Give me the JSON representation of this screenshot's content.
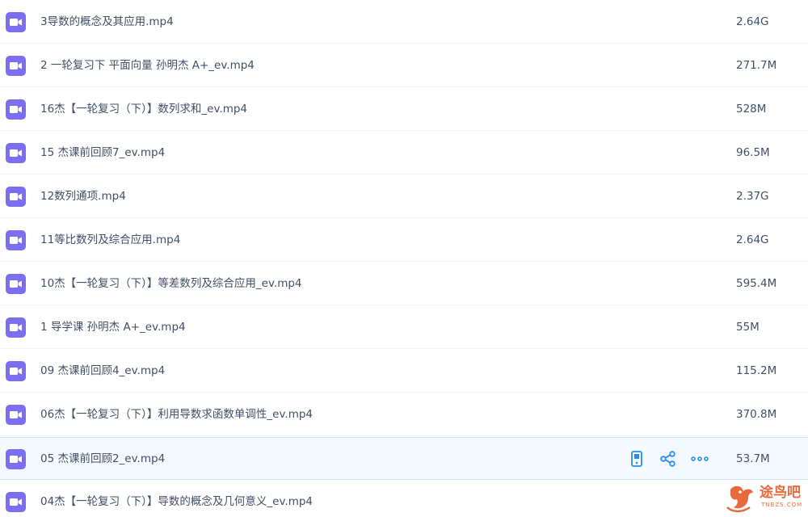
{
  "colors": {
    "icon": "#7b6ff0",
    "text": "#424e67",
    "action": "#2b8cf0",
    "highlight": "#f3f9fe",
    "watermark": "#e8693b"
  },
  "files": [
    {
      "name": "3导数的概念及其应用.mp4",
      "size": "2.64G",
      "icon": "video-file-icon"
    },
    {
      "name": "2 一轮复习下 平面向量 孙明杰 A+_ev.mp4",
      "size": "271.7M",
      "icon": "video-file-icon"
    },
    {
      "name": "16杰【一轮复习（下）】数列求和_ev.mp4",
      "size": "528M",
      "icon": "video-file-icon"
    },
    {
      "name": "15 杰课前回顾7_ev.mp4",
      "size": "96.5M",
      "icon": "video-file-icon"
    },
    {
      "name": "12数列通项.mp4",
      "size": "2.37G",
      "icon": "video-file-icon"
    },
    {
      "name": "11等比数列及综合应用.mp4",
      "size": "2.64G",
      "icon": "video-file-icon"
    },
    {
      "name": "10杰【一轮复习（下）】等差数列及综合应用_ev.mp4",
      "size": "595.4M",
      "icon": "video-file-icon"
    },
    {
      "name": "1 导学课 孙明杰 A+_ev.mp4",
      "size": "55M",
      "icon": "video-file-icon"
    },
    {
      "name": "09 杰课前回顾4_ev.mp4",
      "size": "115.2M",
      "icon": "video-file-icon"
    },
    {
      "name": "06杰【一轮复习（下）】利用导数求函数单调性_ev.mp4",
      "size": "370.8M",
      "icon": "video-file-icon"
    },
    {
      "name": "05 杰课前回顾2_ev.mp4",
      "size": "53.7M",
      "icon": "video-file-icon",
      "hovered": true
    },
    {
      "name": "04杰【一轮复习（下）】导数的概念及几何意义_ev.mp4",
      "size": "",
      "icon": "video-file-icon"
    }
  ],
  "row_actions": [
    {
      "name": "phone-icon"
    },
    {
      "name": "share-icon"
    },
    {
      "name": "more-icon"
    }
  ],
  "watermark": {
    "text": "途鸟吧",
    "sub": "TNBZS.COM"
  }
}
